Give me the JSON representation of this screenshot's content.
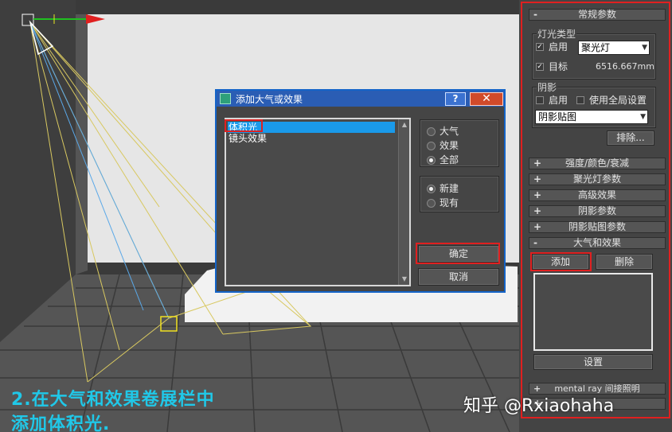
{
  "dialog": {
    "title": "添加大气或效果",
    "help_label": "?",
    "close_label": "✕",
    "list_items": [
      "体积光",
      "镜头效果"
    ],
    "type_options": [
      "大气",
      "效果",
      "全部"
    ],
    "mode_options": [
      "新建",
      "现有"
    ],
    "ok_label": "确定",
    "cancel_label": "取消"
  },
  "panel": {
    "general_rollout": "常规参数",
    "light_type_label": "灯光类型",
    "enable_label": "启用",
    "light_type_value": "聚光灯",
    "target_label": "目标",
    "target_distance": "6516.667mm",
    "shadows_label": "阴影",
    "shadow_enable_label": "启用",
    "global_settings_label": "使用全局设置",
    "shadow_type_value": "阴影贴图",
    "exclude_label": "排除...",
    "rollouts": [
      "强度/颜色/衰减",
      "聚光灯参数",
      "高级效果",
      "阴影参数",
      "阴影贴图参数"
    ],
    "atmos_rollout": "大气和效果",
    "add_label": "添加",
    "delete_label": "删除",
    "setup_label": "设置",
    "mental_ray_rollout": "mental ray 间接照明"
  },
  "caption": {
    "line1": "2.在大气和效果卷展栏中",
    "line2": "添加体积光."
  },
  "watermark": "知乎 @Rxiaohaha"
}
